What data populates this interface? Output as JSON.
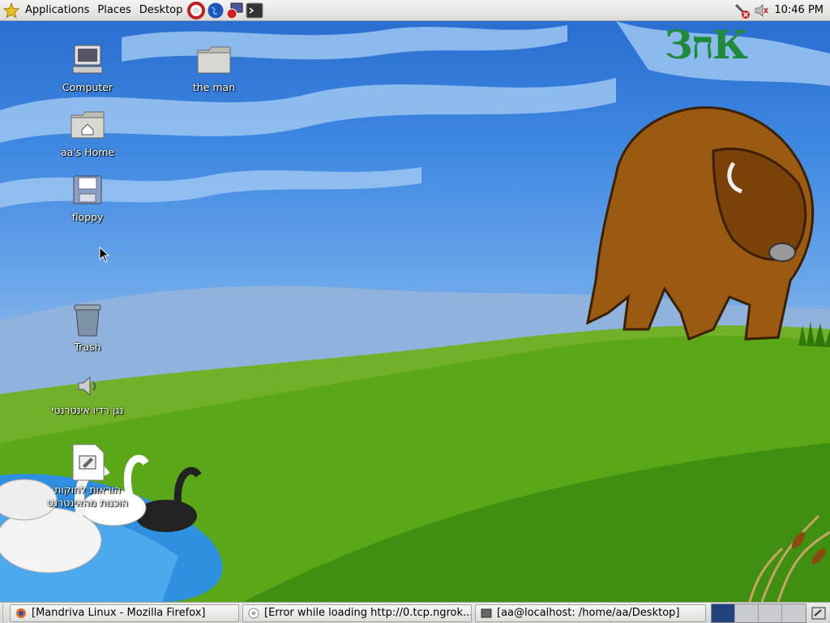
{
  "top_panel": {
    "menus": [
      "Applications",
      "Places",
      "Desktop"
    ],
    "launchers": [
      "help-icon",
      "web-browser-icon",
      "network-tool-icon",
      "terminal-icon"
    ],
    "clock": "10:46 PM"
  },
  "desktop": {
    "wallpaper_logo": "ЗחК",
    "icons": [
      {
        "name": "computer",
        "label": "Computer"
      },
      {
        "name": "the-man-folder",
        "label": "the man"
      },
      {
        "name": "home-folder",
        "label": "aa's Home"
      },
      {
        "name": "floppy",
        "label": "floppy"
      },
      {
        "name": "trash",
        "label": "Trash"
      },
      {
        "name": "radio-player",
        "label": "נגן רדיו אינטרנטי"
      },
      {
        "name": "document",
        "label": "הוראות לחוקות הוכנות מהאינטרנט"
      }
    ]
  },
  "taskbar": {
    "tasks": [
      {
        "label": "[Mandriva Linux - Mozilla Firefox]"
      },
      {
        "label": "[Error while loading http://0.tcp.ngrok..."
      },
      {
        "label": "[aa@localhost: /home/aa/Desktop]"
      }
    ],
    "workspaces": 4,
    "active_workspace": 1
  },
  "colors": {
    "sky": "#3f88e2",
    "grass": "#5aa818",
    "selected_workspace": "#22437e"
  }
}
